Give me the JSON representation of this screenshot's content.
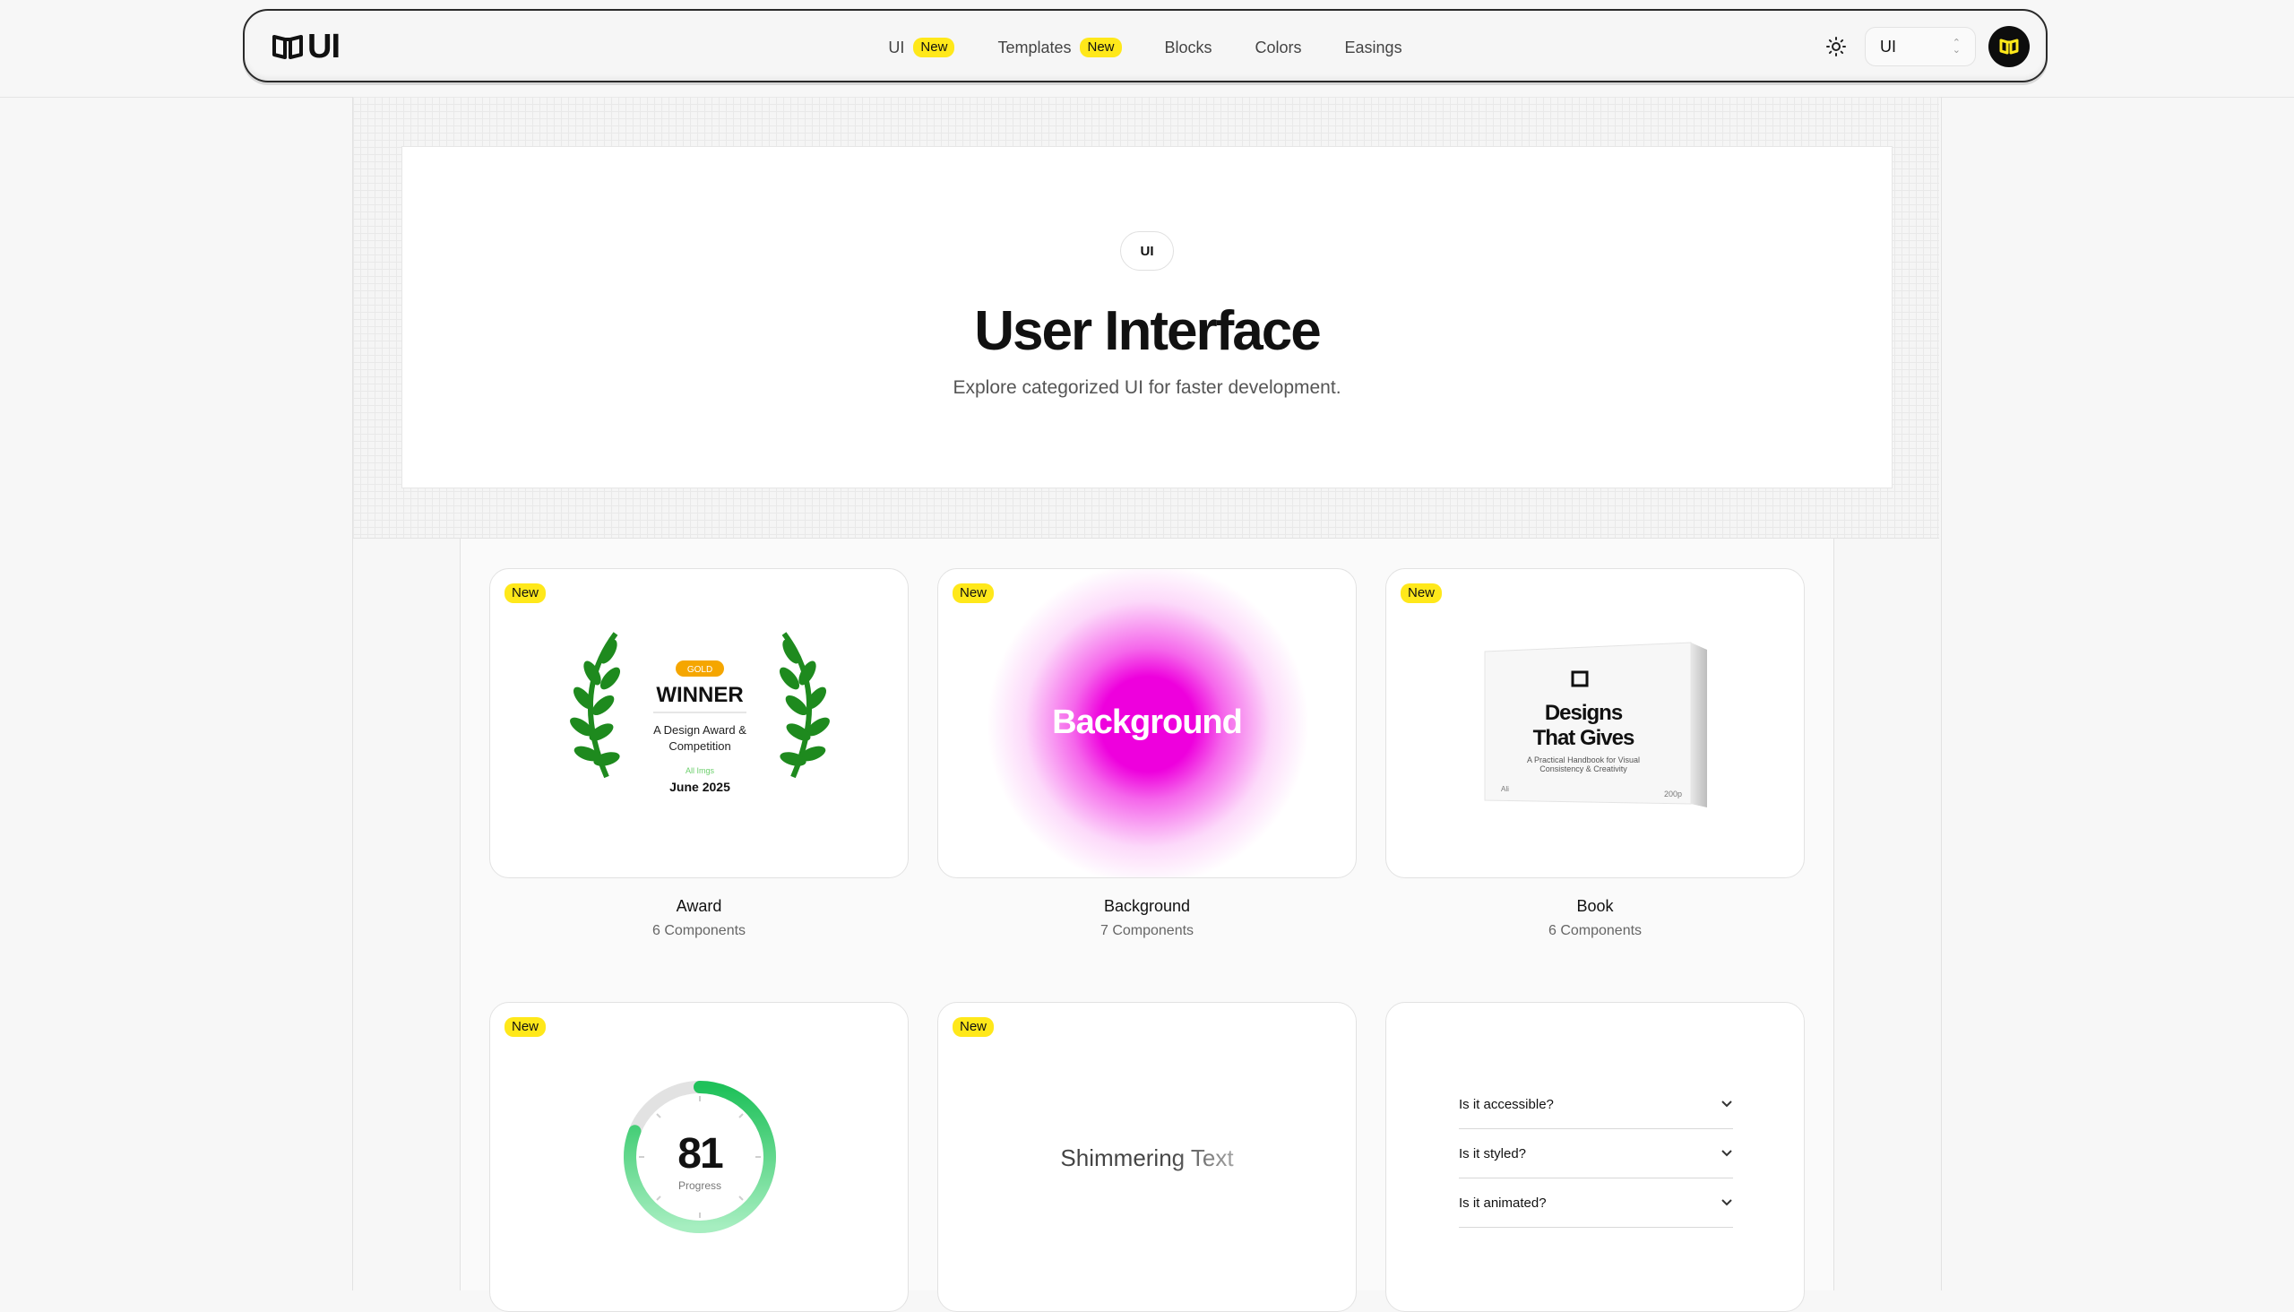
{
  "brand": {
    "logo_text": "UI"
  },
  "nav": {
    "links": [
      {
        "label": "UI",
        "badge": "New"
      },
      {
        "label": "Templates",
        "badge": "New"
      },
      {
        "label": "Blocks"
      },
      {
        "label": "Colors"
      },
      {
        "label": "Easings"
      }
    ],
    "select_value": "UI"
  },
  "hero": {
    "chip": "UI",
    "title": "User Interface",
    "subtitle": "Explore categorized UI for faster development."
  },
  "cards": [
    {
      "label": "Award",
      "count": "6 Components",
      "badge": "New"
    },
    {
      "label": "Background",
      "count": "7 Components",
      "badge": "New"
    },
    {
      "label": "Book",
      "count": "6 Components",
      "badge": "New"
    },
    {
      "badge": "New"
    },
    {
      "badge": "New"
    },
    {}
  ],
  "award": {
    "tag": "GOLD",
    "title": "WINNER",
    "line1": "A Design Award &",
    "line2": "Competition",
    "small": "All Imgs",
    "date": "June 2025"
  },
  "background_preview": {
    "text": "Background",
    "color": "#ee00dd"
  },
  "book": {
    "title_line1": "Designs",
    "title_line2": "That Gives",
    "sub_line1": "A Practical Handbook for Visual",
    "sub_line2": "Consistency & Creativity",
    "corner_left": "Ali",
    "corner_right": "200p"
  },
  "progress": {
    "value": "81",
    "label": "Progress",
    "fraction": 0.81,
    "color": "#1fc15a"
  },
  "shimmer": {
    "text": "Shimmering Text"
  },
  "faq": {
    "items": [
      {
        "question": "Is it accessible?"
      },
      {
        "question": "Is it styled?"
      },
      {
        "question": "Is it animated?"
      }
    ]
  },
  "colors": {
    "accent": "#ffe81a",
    "dark": "#0d0d0d"
  }
}
